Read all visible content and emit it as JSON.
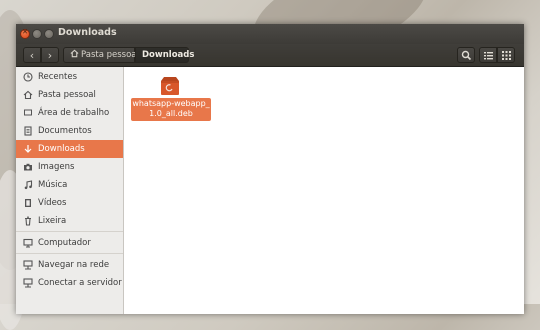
{
  "window": {
    "title": "Downloads"
  },
  "toolbar": {
    "breadcrumb_home": "Pasta pessoal",
    "breadcrumb_current": "Downloads"
  },
  "sidebar": {
    "items": [
      {
        "label": "Recentes",
        "icon": "clock-icon"
      },
      {
        "label": "Pasta pessoal",
        "icon": "home-icon"
      },
      {
        "label": "Área de trabalho",
        "icon": "desktop-icon"
      },
      {
        "label": "Documentos",
        "icon": "document-icon"
      },
      {
        "label": "Downloads",
        "icon": "download-icon",
        "selected": true
      },
      {
        "label": "Imagens",
        "icon": "camera-icon"
      },
      {
        "label": "Música",
        "icon": "music-icon"
      },
      {
        "label": "Vídeos",
        "icon": "film-icon"
      },
      {
        "label": "Lixeira",
        "icon": "trash-icon"
      },
      {
        "label": "Computador",
        "icon": "computer-icon"
      },
      {
        "label": "Navegar na rede",
        "icon": "network-icon"
      },
      {
        "label": "Conectar a servidor",
        "icon": "server-icon"
      }
    ]
  },
  "files": [
    {
      "name_line1": "whatsapp-webapp_",
      "name_line2": "1.0_all.deb",
      "icon": "debian-package-icon",
      "selected": true
    }
  ],
  "colors": {
    "accent": "#e8774a",
    "titlebar": "#3d3b37"
  }
}
